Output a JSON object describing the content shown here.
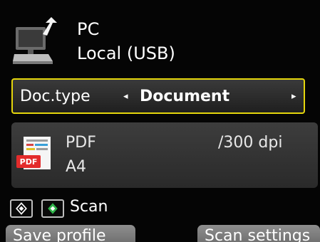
{
  "destination": {
    "name": "PC",
    "connection": "Local (USB)",
    "icon": "computer-icon"
  },
  "doc_type": {
    "label": "Doc.type",
    "left_arrow": "◂",
    "value": "Document",
    "right_arrow": "▸"
  },
  "scan_settings_panel": {
    "format": "PDF",
    "resolution": "/300 dpi",
    "size": "A4",
    "icon": "pdf-icon",
    "icon_badge": "PDF"
  },
  "start": {
    "bw_icon": "black-start-icon",
    "color_icon": "color-start-icon",
    "label": "Scan"
  },
  "softkeys": {
    "left_label": "Save profile",
    "right_label": "Scan settings"
  },
  "colors": {
    "highlight": "#e5d60c",
    "accent_green": "#2fb44a",
    "pdf_red": "#e32b2b"
  }
}
